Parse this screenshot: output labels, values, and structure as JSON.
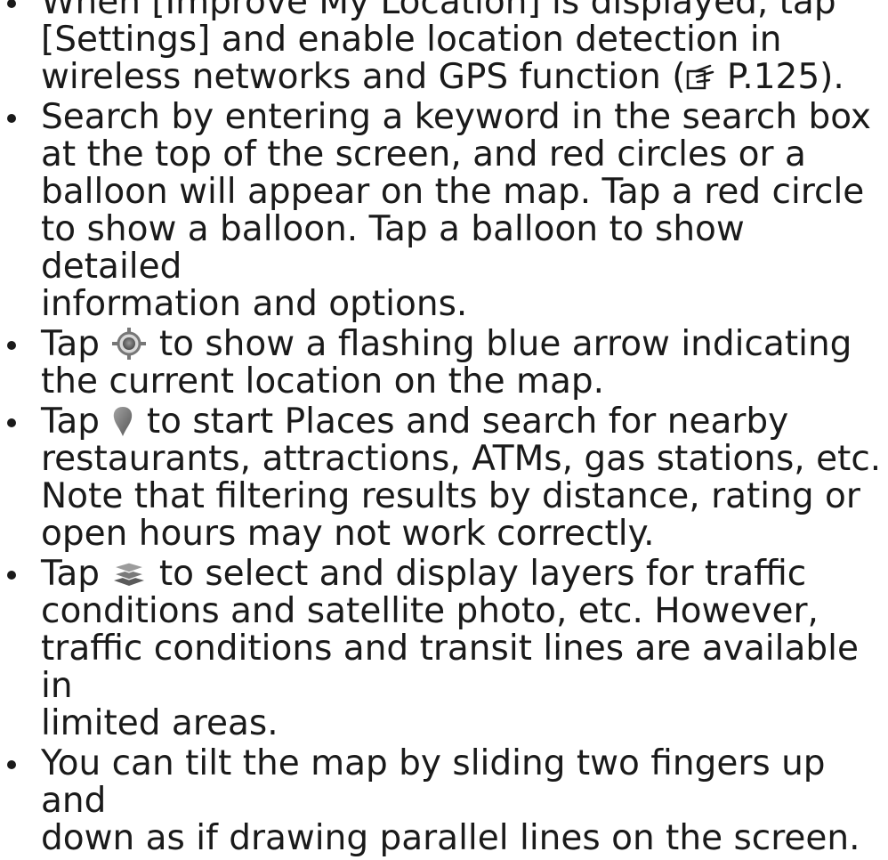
{
  "bullets": [
    {
      "lines": [
        "When [Improve My Location] is displayed, tap",
        "[Settings] and enable location detection in"
      ],
      "last_pre": "wireless networks and GPS function (",
      "ref_icon": "pointing-hand-reference-icon",
      "last_post": " P.125)."
    },
    {
      "lines": [
        "Search by entering a keyword in the search box",
        "at the top of the screen, and red circles or a",
        "balloon will appear on the map. Tap a red circle",
        "to show a balloon. Tap a balloon to show detailed",
        "information and options."
      ]
    },
    {
      "pre": "Tap ",
      "icon": "my-location-target-icon",
      "post": " to show a flashing blue arrow indicating",
      "lines": [
        "the current location on the map."
      ]
    },
    {
      "pre": "Tap ",
      "icon": "places-pin-icon",
      "post": " to start Places and search for nearby",
      "lines": [
        "restaurants, attractions, ATMs, gas stations, etc.",
        "Note that filtering results by distance, rating or",
        "open hours may not work correctly."
      ]
    },
    {
      "pre": "Tap ",
      "icon": "layers-icon",
      "post": " to select and display layers for traffic",
      "lines": [
        "conditions and satellite photo, etc. However,",
        "traffic conditions and transit lines are available in",
        "limited areas."
      ]
    },
    {
      "lines": [
        "You can tilt the map by sliding two fingers up and",
        "down as if drawing parallel lines on the screen."
      ]
    }
  ]
}
